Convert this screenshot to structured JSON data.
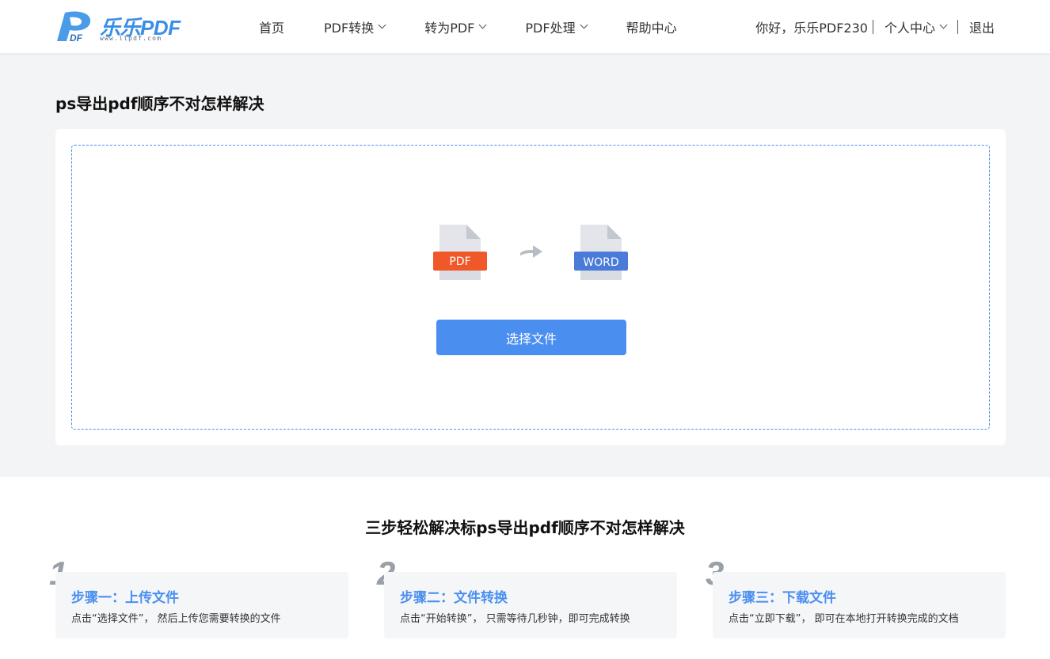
{
  "header": {
    "logo_text": "乐乐PDF",
    "logo_url": "www.llpdf.com",
    "nav": [
      {
        "label": "首页",
        "dropdown": false
      },
      {
        "label": "PDF转换",
        "dropdown": true
      },
      {
        "label": "转为PDF",
        "dropdown": true
      },
      {
        "label": "PDF处理",
        "dropdown": true
      },
      {
        "label": "帮助中心",
        "dropdown": false
      }
    ],
    "greeting": "你好，乐乐PDF230",
    "user_center": "个人中心",
    "logout": "退出"
  },
  "main": {
    "title": "ps导出pdf顺序不对怎样解决",
    "from_format": "PDF",
    "to_format": "WORD",
    "select_button": "选择文件"
  },
  "steps": {
    "title": "三步轻松解决标ps导出pdf顺序不对怎样解决",
    "items": [
      {
        "num": "1",
        "title": "步骤一：上传文件",
        "desc": "点击“选择文件”， 然后上传您需要转换的文件"
      },
      {
        "num": "2",
        "title": "步骤二：文件转换",
        "desc": "点击“开始转换”， 只需等待几秒钟，即可完成转换"
      },
      {
        "num": "3",
        "title": "步骤三：下载文件",
        "desc": "点击“立即下载”， 即可在本地打开转换完成的文档"
      }
    ]
  },
  "colors": {
    "accent": "#4a8ff0",
    "pdf_band": "#f0582a",
    "word_band": "#4a7bd8"
  }
}
